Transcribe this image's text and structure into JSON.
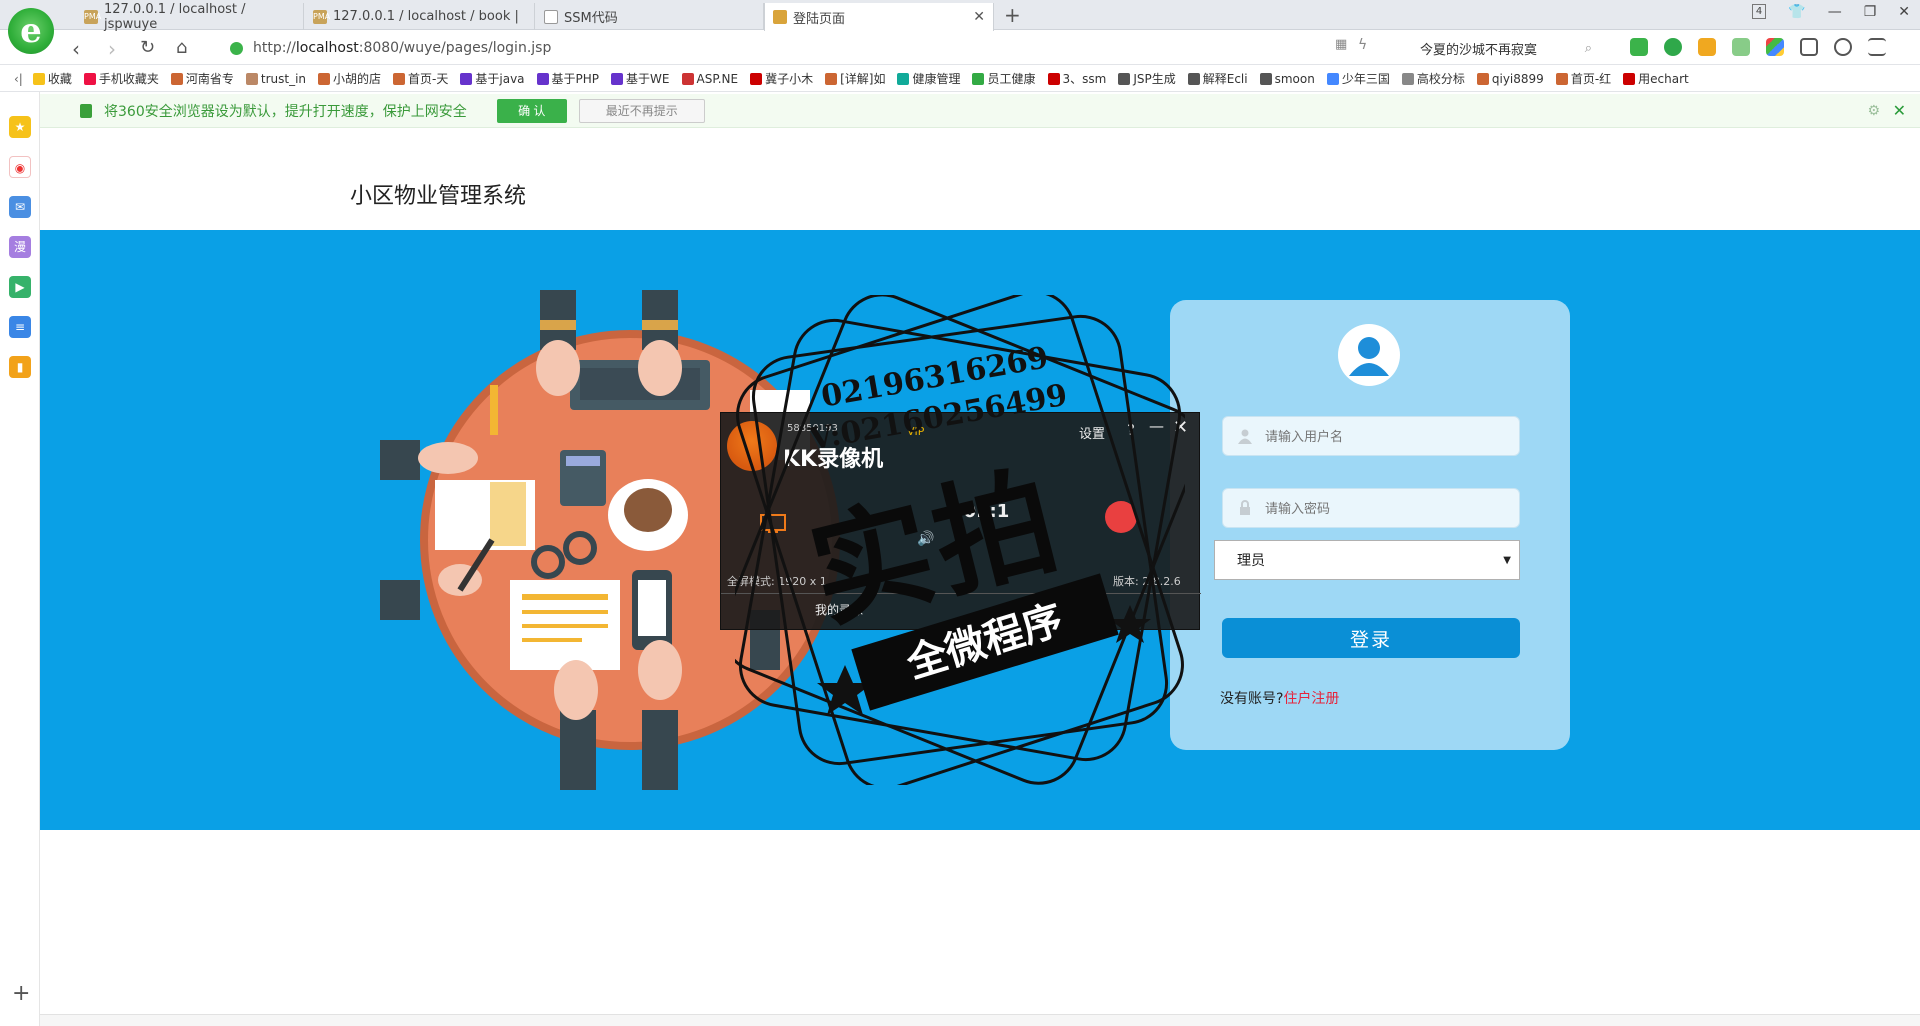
{
  "browser": {
    "tabs": [
      {
        "label": "127.0.0.1 / localhost / jspwuye",
        "favicon": "PMA"
      },
      {
        "label": "127.0.0.1 / localhost / book | ",
        "favicon": "PMA"
      },
      {
        "label": "SSM代码",
        "favicon": ""
      },
      {
        "label": "登陆页面",
        "favicon": ""
      }
    ],
    "tab_count_badge": "4",
    "url_host": "localhost",
    "url_prefix": "http://",
    "url_rest": ":8080/wuye/pages/login.jsp",
    "search_text": "今夏的沙城不再寂寞",
    "bookmarks": [
      "收藏",
      "手机收藏夹",
      "河南省专",
      "trust_in",
      "小胡的店",
      "首页-天",
      "基于java",
      "基于PHP",
      "基于WE",
      "ASP.NE",
      "冀子小木",
      "[详解]如",
      "健康管理",
      "员工健康",
      "3、ssm",
      "JSP生成",
      "解释Ecli",
      "smoon",
      "少年三国",
      "高校分标",
      "qiyi8899",
      "首页-红",
      "用echart"
    ],
    "notice": {
      "text": "将360安全浏览器设为默认，提升打开速度，保护上网安全",
      "confirm": "确 认",
      "later": "最近不再提示"
    }
  },
  "page": {
    "site_title": "小区物业管理系统",
    "login": {
      "username_placeholder": "请输入用户名",
      "password_placeholder": "请输入密码",
      "role_selected": "理员",
      "submit": "登录",
      "no_account": "没有账号?",
      "register_link": "住户注册"
    }
  },
  "overlay": {
    "kk": {
      "name": "KK录像机",
      "user_id": "58850193",
      "vip": "VIP",
      "settings": "设置",
      "help": "?",
      "timer": "00:  :1",
      "mode": "全屏模式: 1920 x 1",
      "version": "版本: 2.8.2.6",
      "my_records": "我的录像"
    },
    "watermark_numbers": [
      "02196316269",
      "V:02160256499"
    ],
    "stamp_main": "实拍",
    "stamp_ribbon": "全微程序"
  },
  "colors": {
    "banner": "#0aa0e6",
    "panel": "#9ed8f5",
    "button": "#0a8fd6",
    "register_link": "#e6243b"
  }
}
